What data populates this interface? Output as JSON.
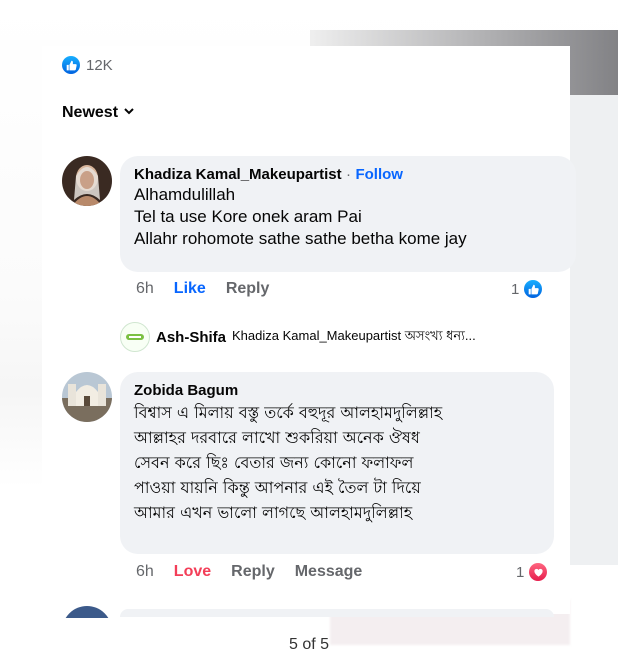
{
  "reactions": {
    "count": "12K",
    "icon": "like-icon"
  },
  "sort": {
    "label": "Newest",
    "icon": "chevron-down-icon"
  },
  "comments": [
    {
      "author": "Khadiza Kamal_Makeupartist",
      "separator": "·",
      "follow_label": "Follow",
      "lines": [
        "Alhamdulillah",
        "Tel ta use Kore onek aram Pai",
        "Allahr rohomote sathe sathe betha kome jay"
      ],
      "time": "6h",
      "like_label": "Like",
      "reply_label": "Reply",
      "reaction_count": "1",
      "reaction": "like"
    },
    {
      "author": "Zobida Bagum",
      "lines": [
        "বিশ্বাস এ মিলায় বস্তু তর্কে বহুদূর আলহামদুলিল্লাহ",
        "আল্লাহর দরবারে লাখো শুকরিয়া অনেক ঔষধ",
        "সেবন করে ছিঃ বেতার জন্য কোনো ফলাফল",
        "পাওয়া যায়নি কিন্তু আপনার এই তৈল টা দিয়ে",
        "আমার এখন ভালো লাগছে আলহামদুলিল্লাহ"
      ],
      "time": "6h",
      "love_label": "Love",
      "reply_label": "Reply",
      "message_label": "Message",
      "reaction_count": "1",
      "reaction": "love"
    }
  ],
  "reply_preview": {
    "author": "Ash-Shifa",
    "text": "Khadiza Kamal_Makeupartist অসংখ্য ধন্য..."
  },
  "pager": "5 of 5",
  "colors": {
    "accent": "#0866ff",
    "love": "#f33e58",
    "bubble": "#f0f2f5",
    "meta": "#65676b"
  }
}
